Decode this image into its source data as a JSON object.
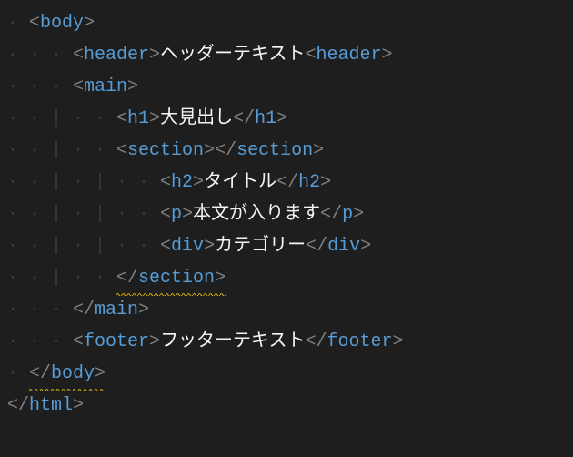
{
  "guides": {
    "d0": " ",
    "d1": "· ",
    "d1g": "· · · ",
    "d2": "· · | ",
    "d2g": "· · | · · ",
    "d3": "· · | · | ",
    "d3g": "· · | · | · · ",
    "none": ""
  },
  "tags": {
    "body_open": "body",
    "body_close": "body",
    "header_open": "header",
    "header_close_wrong": "header",
    "main_open": "main",
    "main_close": "main",
    "h1_open": "h1",
    "h1_close": "h1",
    "section_open": "section",
    "section_close": "section",
    "h2_open": "h2",
    "h2_close": "h2",
    "p_open": "p",
    "p_close": "p",
    "div_open": "div",
    "div_close": "div",
    "footer_open": "footer",
    "footer_close": "footer",
    "html_close": "html"
  },
  "content": {
    "header_text": "ヘッダーテキスト",
    "h1_text": "大見出し",
    "h2_text": "タイトル",
    "p_text": "本文が入ります",
    "div_text": "カテゴリー",
    "footer_text": "フッターテキスト"
  }
}
